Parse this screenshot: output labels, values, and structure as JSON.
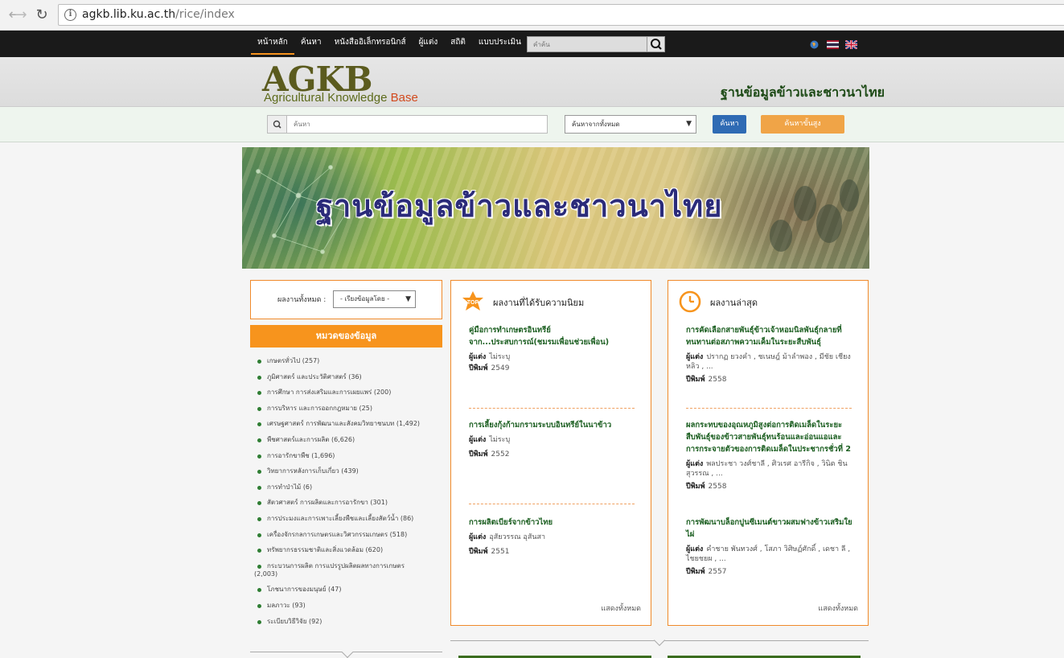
{
  "browser": {
    "url_host": "agkb.lib.ku.ac.th",
    "url_path": "/rice/index"
  },
  "topnav": {
    "items": [
      "หน้าหลัก",
      "ค้นหา",
      "หนังสืออิเล็กทรอนิกส์",
      "ผู้แต่ง",
      "สถิติ",
      "แบบประเมิน"
    ],
    "search_placeholder": "คำค้น"
  },
  "header": {
    "logo_big": "AGKB",
    "logo_sub_1": "Agricultural Knowledge",
    "logo_sub_2": "Base",
    "tagline": "ฐานข้อมูลข้าวและชาวนาไทย"
  },
  "search": {
    "placeholder": "ค้นหา",
    "scope_selected": "ค้นหาจากทั้งหมด",
    "submit_label": "ค้นหา",
    "advanced_label": "ค้นหาขั้นสูง"
  },
  "hero": {
    "title": "ฐานข้อมูลข้าวและชาวนาไทย"
  },
  "sidebar": {
    "filter_label": "ผลงานทั้งหมด :",
    "filter_selected": "- เรียงข้อมูลโดย -",
    "category_header": "หมวดของข้อมูล",
    "categories": [
      {
        "name": "เกษตรทั่วไป",
        "count": "(257)"
      },
      {
        "name": "ภูมิศาสตร์ และประวัติศาสตร์",
        "count": "(36)"
      },
      {
        "name": "การศึกษา การส่งเสริมและการเผยแพร่",
        "count": "(200)"
      },
      {
        "name": "การบริหาร และการออกกฎหมาย",
        "count": "(25)"
      },
      {
        "name": "เศรษฐศาสตร์ การพัฒนาและสังคมวิทยาชนบท",
        "count": "(1,492)"
      },
      {
        "name": "พืชศาสตร์และการผลิต",
        "count": "(6,626)"
      },
      {
        "name": "การอารักขาพืช",
        "count": "(1,696)"
      },
      {
        "name": "วิทยาการหลังการเก็บเกี่ยว",
        "count": "(439)"
      },
      {
        "name": "การทำป่าไม้",
        "count": "(6)"
      },
      {
        "name": "สัตวศาสตร์ การผลิตและการอารักขา",
        "count": "(301)"
      },
      {
        "name": "การประมงและการเพาะเลี้ยงพืชและเลี้ยงสัตว์น้ำ",
        "count": "(86)"
      },
      {
        "name": "เครื่องจักรกลการเกษตรและวิศวกรรมเกษตร",
        "count": "(518)"
      },
      {
        "name": "ทรัพยากรธรรมชาติและสิ่งแวดล้อม",
        "count": "(620)"
      },
      {
        "name": "กระบวนการผลิต การแปรรูปผลิตผลทางการเกษตร",
        "count": "(2,003)"
      },
      {
        "name": "โภชนาการของมนุษย์",
        "count": "(47)"
      },
      {
        "name": "มลภาวะ",
        "count": "(93)"
      },
      {
        "name": "ระเบียบวิธีวิจัย",
        "count": "(92)"
      }
    ]
  },
  "popular": {
    "badge": "TOP",
    "title": "ผลงานที่ได้รับความนิยม",
    "author_label": "ผู้แต่ง",
    "year_label": "ปีพิมพ์",
    "show_all": "แสดงทั้งหมด",
    "items": [
      {
        "title": "คู่มือการทำเกษตรอินทรีย์ จาก...ประสบการณ์(ชมรมเพื่อนช่วยเพื่อน)",
        "author": "ไม่ระบุ",
        "year": "2549"
      },
      {
        "title": "การเลี้ยงกุ้งก้ามกรามระบบอินทรีย์ในนาข้าว",
        "author": "ไม่ระบุ",
        "year": "2552"
      },
      {
        "title": "การผลิตเบียร์จากข้าวไทย",
        "author": "อุสัยวรรณ อุสันสา",
        "year": "2551"
      }
    ]
  },
  "latest": {
    "title": "ผลงานล่าสุด",
    "author_label": "ผู้แต่ง",
    "year_label": "ปีพิมพ์",
    "show_all": "แสดงทั้งหมด",
    "items": [
      {
        "title": "การคัดเลือกสายพันธุ์ข้าวเจ้าหอมนิลพันธุ์กลายที่ทนทานต่อสภาพความเค็มในระยะสืบพันธุ์",
        "author": "ปรากฏ ยวงคำ , ชเนษฎ์ ม้าลำพอง , มีชัย เชียงหลิว , ...",
        "year": "2558"
      },
      {
        "title": "ผลกระทบของอุณหภูมิสูงต่อการติดเมล็ดในระยะสืบพันธุ์ของข้าวสายพันธุ์ทนร้อนและอ่อนแอและการกระจายตัวของการติดเมล็ดในประชากรชั่วที่ 2",
        "author": "พลประชา วงศ์ชาลี , ศิวเรศ อารีกิจ , วินิต ชินสุวรรณ , ...",
        "year": "2558"
      },
      {
        "title": "การพัฒนาบล็อกปูนซีเมนต์ขาวผสมฟางข้าวเสริมใยไผ่",
        "author": "คำชาย พันทวงศ์ , โสภา วิศิษฏ์ศักดิ์ , เดชา ลี , ไชยชยผ , ...",
        "year": "2557"
      }
    ]
  },
  "colors": {
    "accent": "#f7941d",
    "link": "#1b5e20",
    "nav_bg": "#1a1a1a",
    "button": "#2f6bb4"
  }
}
